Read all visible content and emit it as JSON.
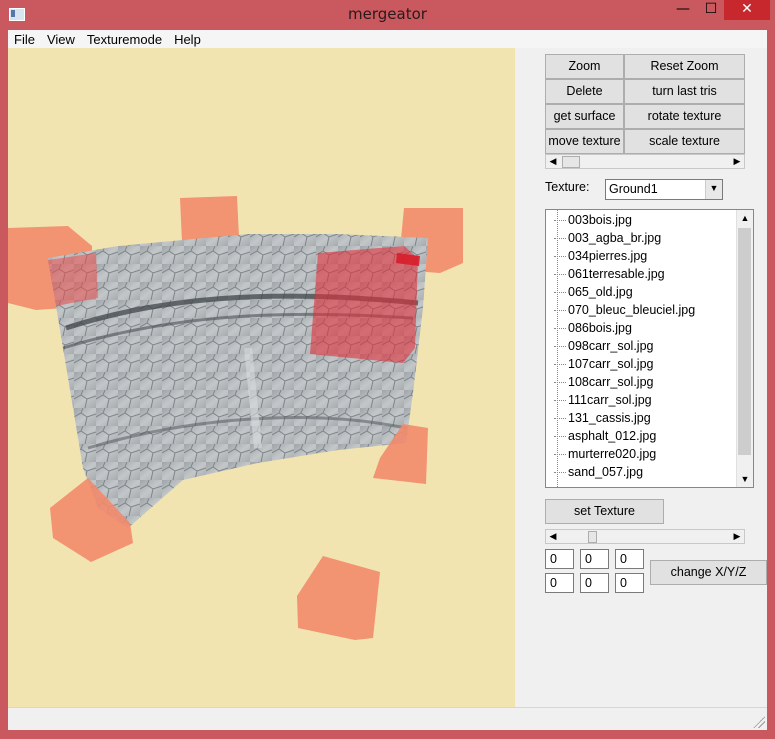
{
  "window": {
    "title": "mergeator",
    "min_glyph": "—",
    "max_glyph": "☐",
    "close_glyph": "✕"
  },
  "menu": [
    "File",
    "View",
    "Texturemode",
    "Help"
  ],
  "buttons": {
    "zoom": "Zoom",
    "reset_zoom": "Reset Zoom",
    "delete": "Delete",
    "turn_last_tris": "turn last tris",
    "get_surface": "get surface",
    "rotate_texture": "rotate texture",
    "move_texture": "move texture",
    "scale_texture": "scale texture",
    "set_texture": "set Texture",
    "change_xyz": "change X/Y/Z"
  },
  "texture": {
    "label": "Texture:",
    "selected": "Ground1"
  },
  "texture_files": [
    "003bois.jpg",
    "003_agba_br.jpg",
    "034pierres.jpg",
    "061terresable.jpg",
    "065_old.jpg",
    "070_bleuc_bleuciel.jpg",
    "086bois.jpg",
    "098carr_sol.jpg",
    "107carr_sol.jpg",
    "108carr_sol.jpg",
    "111carr_sol.jpg",
    "131_cassis.jpg",
    "asphalt_012.jpg",
    "murterre020.jpg",
    "sand_057.jpg"
  ],
  "coords": {
    "row1": [
      "0",
      "0",
      "0"
    ],
    "row2": [
      "0",
      "0",
      "0"
    ]
  },
  "icons": {
    "left_arrow": "◀",
    "right_arrow": "▶",
    "up_arrow": "▲",
    "down_arrow": "▼",
    "dropdown": "▼"
  },
  "colors": {
    "window_frame": "#c9585f",
    "viewport_bg": "#f2e4b1",
    "cube": "#f07860",
    "selected_cube": "#e0303a"
  }
}
